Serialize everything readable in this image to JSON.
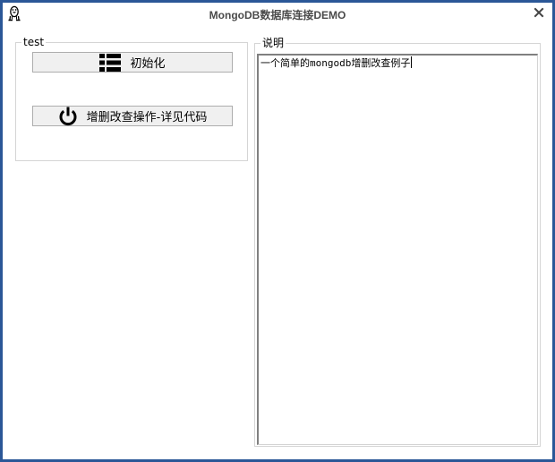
{
  "window": {
    "title": "MongoDB数据库连接DEMO",
    "border_color": "#2b5797"
  },
  "group_test": {
    "legend": "test",
    "buttons": [
      {
        "label": "初始化",
        "icon": "list-icon"
      },
      {
        "label": "增删改查操作-详见代码",
        "icon": "power-icon"
      }
    ]
  },
  "group_desc": {
    "legend": "说明",
    "text": "一个简单的mongodb增删改查例子"
  }
}
